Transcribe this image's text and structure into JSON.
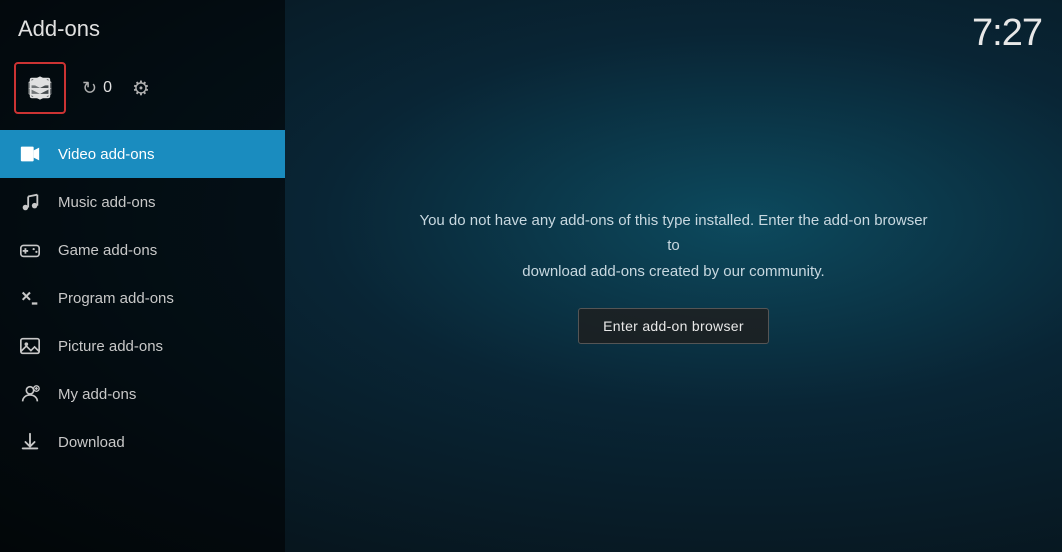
{
  "app": {
    "title": "Add-ons",
    "clock": "7:27"
  },
  "sidebar": {
    "update_count": "0",
    "nav_items": [
      {
        "id": "video-addons",
        "label": "Video add-ons",
        "active": true,
        "icon": "video"
      },
      {
        "id": "music-addons",
        "label": "Music add-ons",
        "active": false,
        "icon": "music"
      },
      {
        "id": "game-addons",
        "label": "Game add-ons",
        "active": false,
        "icon": "game"
      },
      {
        "id": "program-addons",
        "label": "Program add-ons",
        "active": false,
        "icon": "program"
      },
      {
        "id": "picture-addons",
        "label": "Picture add-ons",
        "active": false,
        "icon": "picture"
      },
      {
        "id": "my-addons",
        "label": "My add-ons",
        "active": false,
        "icon": "myaddon"
      },
      {
        "id": "download",
        "label": "Download",
        "active": false,
        "icon": "download"
      }
    ]
  },
  "main": {
    "empty_message_line1": "You do not have any add-ons of this type installed. Enter the add-on browser to",
    "empty_message_line2": "download add-ons created by our community.",
    "enter_browser_label": "Enter add-on browser"
  }
}
